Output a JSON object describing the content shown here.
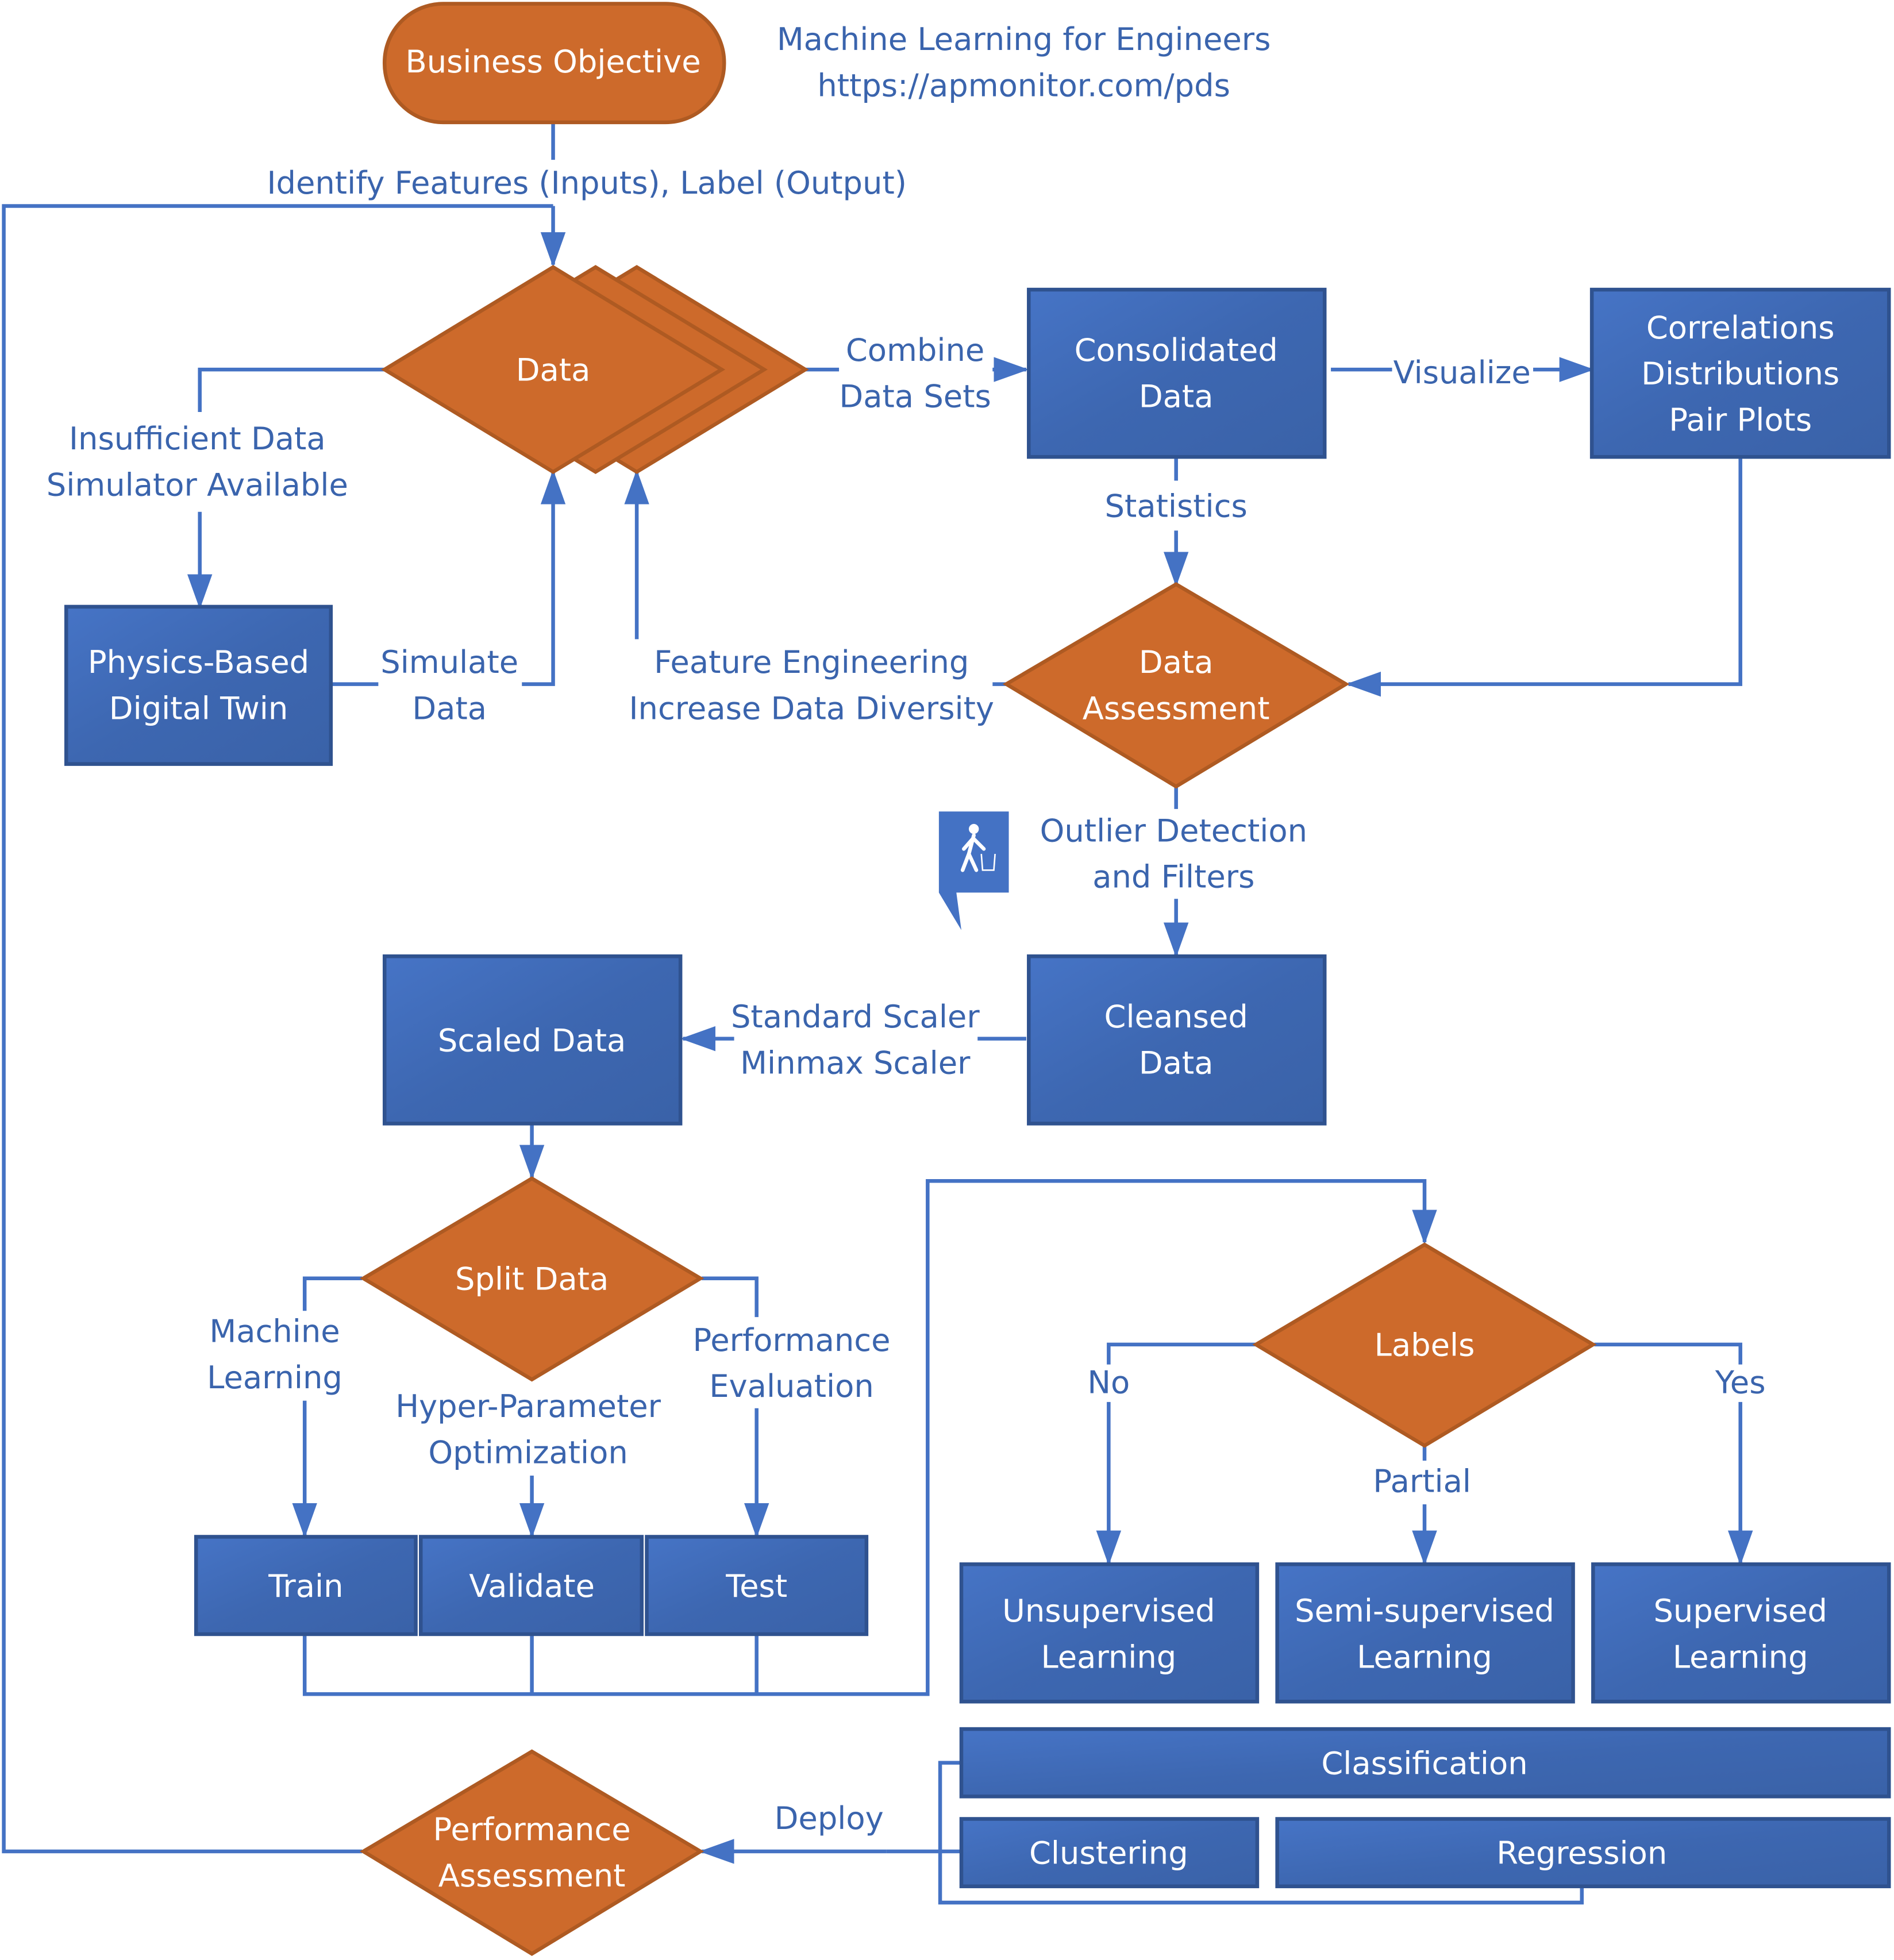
{
  "title": {
    "line1": "Machine Learning for Engineers",
    "line2": "https://apmonitor.com/pds"
  },
  "colors": {
    "process_blue": "#4472c4",
    "decision_orange": "#cd6a2b",
    "label_blue": "#3a64ad"
  },
  "nodes": {
    "business_objective": "Business Objective",
    "data": "Data",
    "consolidated_1": "Consolidated",
    "consolidated_2": "Data",
    "correlations_1": "Correlations",
    "correlations_2": "Distributions",
    "correlations_3": "Pair Plots",
    "physics_1": "Physics-Based",
    "physics_2": "Digital Twin",
    "assessment_1": "Data",
    "assessment_2": "Assessment",
    "scaled": "Scaled Data",
    "cleansed_1": "Cleansed",
    "cleansed_2": "Data",
    "split": "Split Data",
    "train": "Train",
    "validate": "Validate",
    "test": "Test",
    "labels": "Labels",
    "unsup_1": "Unsupervised",
    "unsup_2": "Learning",
    "semi_1": "Semi-supervised",
    "semi_2": "Learning",
    "sup_1": "Supervised",
    "sup_2": "Learning",
    "classification": "Classification",
    "clustering": "Clustering",
    "regression": "Regression",
    "perf_1": "Performance",
    "perf_2": "Assessment"
  },
  "edges": {
    "identify": "Identify Features (Inputs), Label (Output)",
    "combine_1": "Combine",
    "combine_2": "Data Sets",
    "visualize": "Visualize",
    "insufficient_1": "Insufficient Data",
    "insufficient_2": "Simulator Available",
    "simulate_1": "Simulate",
    "simulate_2": "Data",
    "statistics": "Statistics",
    "feature_1": "Feature Engineering",
    "feature_2": "Increase Data Diversity",
    "outlier_1": "Outlier Detection",
    "outlier_2": "and Filters",
    "scaler_1": "Standard Scaler",
    "scaler_2": "Minmax Scaler",
    "ml_1": "Machine",
    "ml_2": "Learning",
    "hyper_1": "Hyper-Parameter",
    "hyper_2": "Optimization",
    "perfeval_1": "Performance",
    "perfeval_2": "Evaluation",
    "no": "No",
    "yes": "Yes",
    "partial": "Partial",
    "deploy": "Deploy"
  },
  "icons": {
    "outlier": "person-discarding-trash-icon"
  }
}
